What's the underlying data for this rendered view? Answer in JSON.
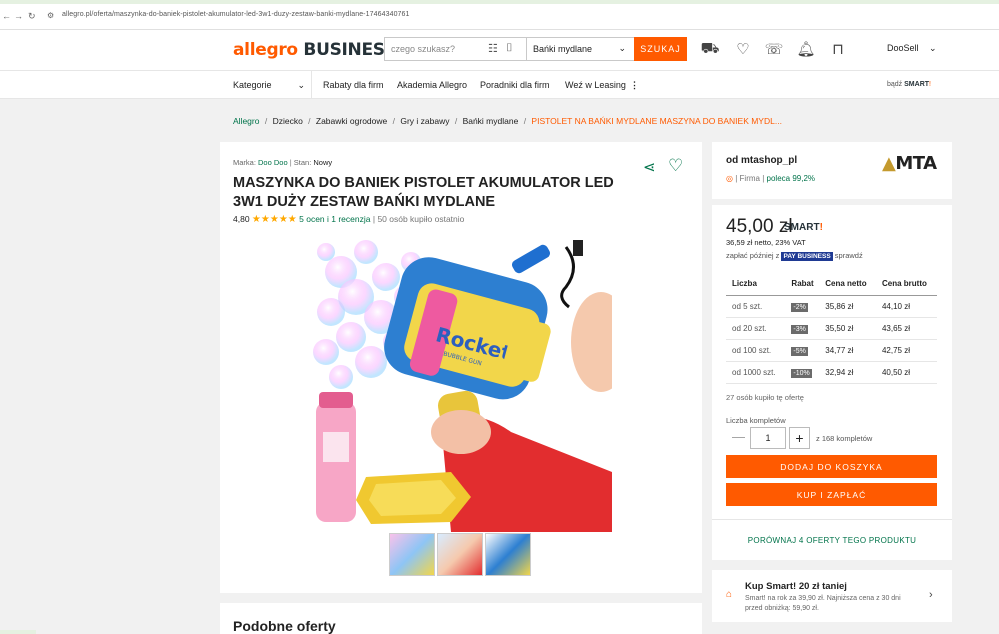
{
  "browser": {
    "url": "allegro.pl/oferta/maszynka-do-baniek-pistolet-akumulator-led-3w1-duzy-zestaw-banki-mydlane-17464340761"
  },
  "header": {
    "logo_brand": "allegro",
    "logo_business": "BUSINESS",
    "search_placeholder": "czego szukasz?",
    "search_category": "Bańki mydlane",
    "search_button": "SZUKAJ",
    "user": "DooSell"
  },
  "nav": {
    "categories": "Kategorie",
    "items": [
      "Rabaty dla firm",
      "Akademia Allegro",
      "Poradniki dla firm",
      "Weź w Leasing"
    ],
    "smart_prefix": "bądź",
    "smart_label": "SMART"
  },
  "breadcrumb": [
    "Allegro",
    "Dziecko",
    "Zabawki ogrodowe",
    "Gry i zabawy",
    "Bańki mydlane",
    "PISTOLET NA BAŃKI MYDLANE MASZYNA DO BANIEK MYDL..."
  ],
  "product": {
    "brand_label": "Marka:",
    "brand": "Doo Doo",
    "condition_label": "Stan:",
    "condition": "Nowy",
    "title": "MASZYNKA DO BANIEK PISTOLET AKUMULATOR LED 3W1 DUŻY ZESTAW BAŃKI MYDLANE",
    "rating": "4,80",
    "reviews": "5 ocen i 1 recenzja",
    "bought": "50 osób kupiło ostatnio",
    "gun_text": "Rocket",
    "gun_subtext": "BUBBLE GUN"
  },
  "seller": {
    "label": "od mtashop_pl",
    "type": "Firma",
    "recommend": "poleca 99,2%",
    "logo_text": "MTA"
  },
  "price": {
    "main": "45,00 zł",
    "smart": "SMART",
    "net": "36,59 zł netto, 23% VAT",
    "paylater_prefix": "zapłać później z",
    "paylater_brand": "PAY BUSINESS",
    "paylater_suffix": "sprawdź"
  },
  "tiers": {
    "headers": [
      "Liczba",
      "Rabat",
      "Cena netto",
      "Cena brutto"
    ],
    "rows": [
      {
        "qty": "od 5 szt.",
        "discount": "-2%",
        "net": "35,86 zł",
        "gross": "44,10 zł"
      },
      {
        "qty": "od 20 szt.",
        "discount": "-3%",
        "net": "35,50 zł",
        "gross": "43,65 zł"
      },
      {
        "qty": "od 100 szt.",
        "discount": "-5%",
        "net": "34,77 zł",
        "gross": "42,75 zł"
      },
      {
        "qty": "od 1000 szt.",
        "discount": "-10%",
        "net": "32,94 zł",
        "gross": "40,50 zł"
      }
    ]
  },
  "purchase": {
    "bought_offer": "27 osób kupiło tę ofertę",
    "qty_label": "Liczba kompletów",
    "qty": "1",
    "stock": "z 168 kompletów",
    "add_to_cart": "DODAJ DO KOSZYKA",
    "buy_now": "KUP I ZAPŁAĆ",
    "compare": "PORÓWNAJ 4 OFERTY TEGO PRODUKTU"
  },
  "smart_promo": {
    "title": "Kup Smart! 20 zł taniej",
    "text": "Smart! na rok za 39,90 zł. Najniższa cena z 30 dni przed obniżką: 59,90 zł."
  },
  "similar": {
    "title": "Podobne oferty"
  },
  "colors": {
    "accent": "#ff5a00",
    "link": "#00734a",
    "star": "#ffa800"
  }
}
